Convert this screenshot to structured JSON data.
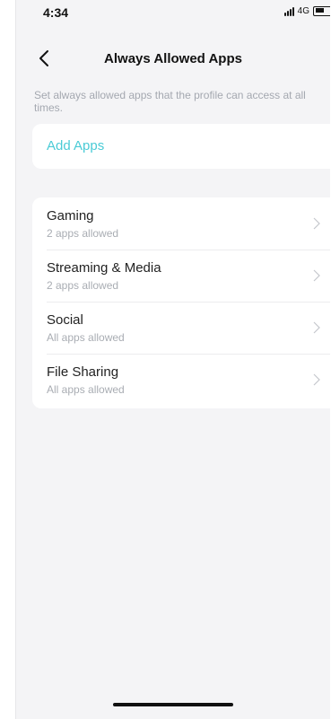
{
  "status_bar": {
    "time": "4:34",
    "network": "4G"
  },
  "header": {
    "title": "Always Allowed Apps",
    "back_icon": "chevron-left-icon"
  },
  "description": "Set always allowed apps that the profile can access at all times.",
  "add_apps": {
    "label": "Add Apps",
    "color": "#4acbd6"
  },
  "categories": [
    {
      "name": "Gaming",
      "status": "2 apps allowed"
    },
    {
      "name": "Streaming & Media",
      "status": "2 apps allowed"
    },
    {
      "name": "Social",
      "status": "All apps allowed"
    },
    {
      "name": "File Sharing",
      "status": "All apps allowed"
    }
  ]
}
